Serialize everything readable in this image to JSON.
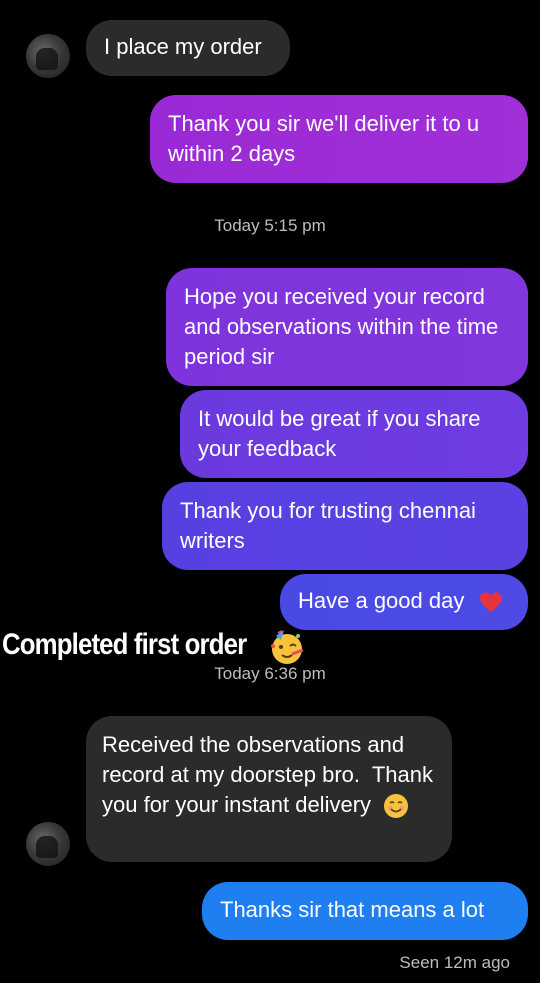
{
  "messages": {
    "m1": "I place my order",
    "m2": "Thank you sir we'll deliver it to u within 2 days",
    "ts1": "Today 5:15 pm",
    "m3": "Hope you received your record and observations within the time period sir",
    "m4": "It would be great if you share your feedback",
    "m5": "Thank you for trusting chennai writers",
    "m6": "Have a good day",
    "ts2": "Today 6:36 pm",
    "m7": "Received the observations and record at my doorstep bro.  Thank you for your instant delivery",
    "m8": "Thanks sir that means a lot"
  },
  "sticker_text": "Completed first order",
  "seen": "Seen 12m ago",
  "colors": {
    "background": "#000000",
    "incoming_bubble": "#2b2b2b",
    "outgoing_purple": "#9b2bd6",
    "outgoing_indigo": "#5a3de0",
    "outgoing_blue": "#1f7ef0"
  },
  "icons": [
    "avatar-icon",
    "heart-emoji-icon",
    "party-face-emoji-icon",
    "smiling-face-emoji-icon"
  ]
}
